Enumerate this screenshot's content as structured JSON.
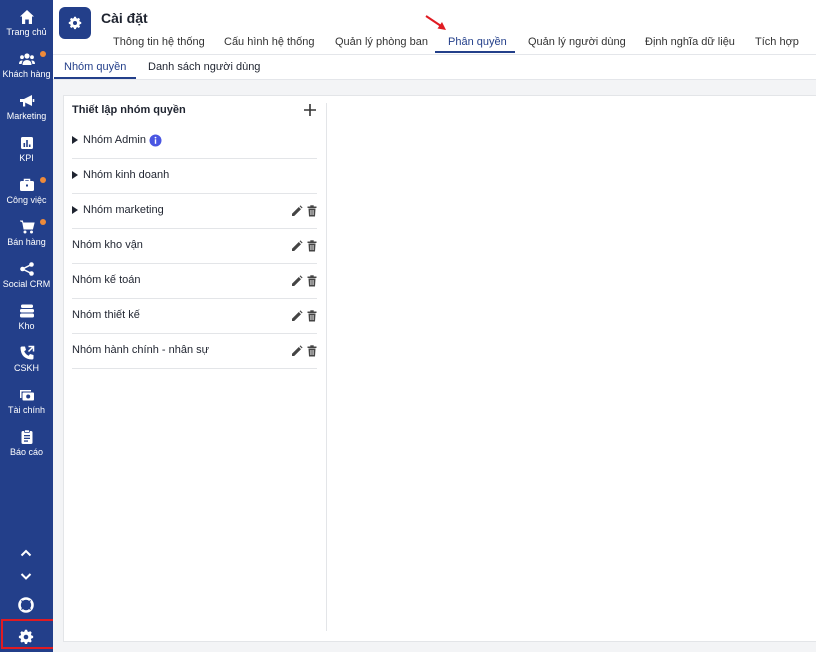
{
  "sidebar": {
    "items": [
      {
        "label": "Trang chủ",
        "icon": "home-icon",
        "badge": false
      },
      {
        "label": "Khách hàng",
        "icon": "people-icon",
        "badge": true
      },
      {
        "label": "Marketing",
        "icon": "megaphone-icon",
        "badge": false
      },
      {
        "label": "KPI",
        "icon": "bar-chart-icon",
        "badge": false
      },
      {
        "label": "Công việc",
        "icon": "briefcase-icon",
        "badge": true
      },
      {
        "label": "Bán hàng",
        "icon": "cart-icon",
        "badge": true
      },
      {
        "label": "Social CRM",
        "icon": "share-icon",
        "badge": false
      },
      {
        "label": "Kho",
        "icon": "warehouse-icon",
        "badge": false
      },
      {
        "label": "CSKH",
        "icon": "phone-icon",
        "badge": false
      },
      {
        "label": "Tài chính",
        "icon": "money-icon",
        "badge": false
      },
      {
        "label": "Báo cáo",
        "icon": "clipboard-icon",
        "badge": false
      }
    ],
    "bottom": [
      "chevron-up-icon",
      "chevron-down-icon",
      "support-icon",
      "gear-icon"
    ]
  },
  "header": {
    "title": "Cài đặt",
    "tabs": [
      {
        "label": "Thông tin hệ thống"
      },
      {
        "label": "Cấu hình hệ thống"
      },
      {
        "label": "Quản lý phòng ban"
      },
      {
        "label": "Phân quyền",
        "active": true
      },
      {
        "label": "Quản lý người dùng"
      },
      {
        "label": "Định nghĩa dữ liệu"
      },
      {
        "label": "Tích hợp"
      }
    ]
  },
  "subtabs": [
    {
      "label": "Nhóm quyền",
      "active": true
    },
    {
      "label": "Danh sách người dùng"
    }
  ],
  "panel": {
    "title": "Thiết lập nhóm quyền",
    "groups": [
      {
        "label": "Nhóm Admin",
        "expandable": true,
        "info": true,
        "actions": false
      },
      {
        "label": "Nhóm kinh doanh",
        "expandable": true,
        "info": false,
        "actions": false
      },
      {
        "label": "Nhóm marketing",
        "expandable": true,
        "info": false,
        "actions": true
      },
      {
        "label": "Nhóm kho vận",
        "expandable": false,
        "info": false,
        "actions": true
      },
      {
        "label": "Nhóm kế toán",
        "expandable": false,
        "info": false,
        "actions": true
      },
      {
        "label": "Nhóm thiết kế",
        "expandable": false,
        "info": false,
        "actions": true
      },
      {
        "label": "Nhóm hành chính - nhân sự",
        "expandable": false,
        "info": false,
        "actions": true
      }
    ]
  },
  "colors": {
    "sidebar": "#233f8a",
    "accent": "#233f8a",
    "badge": "#ee8a3a",
    "highlight_box": "#e01b22",
    "arrow": "#e01b22",
    "info": "#4a56e2"
  }
}
